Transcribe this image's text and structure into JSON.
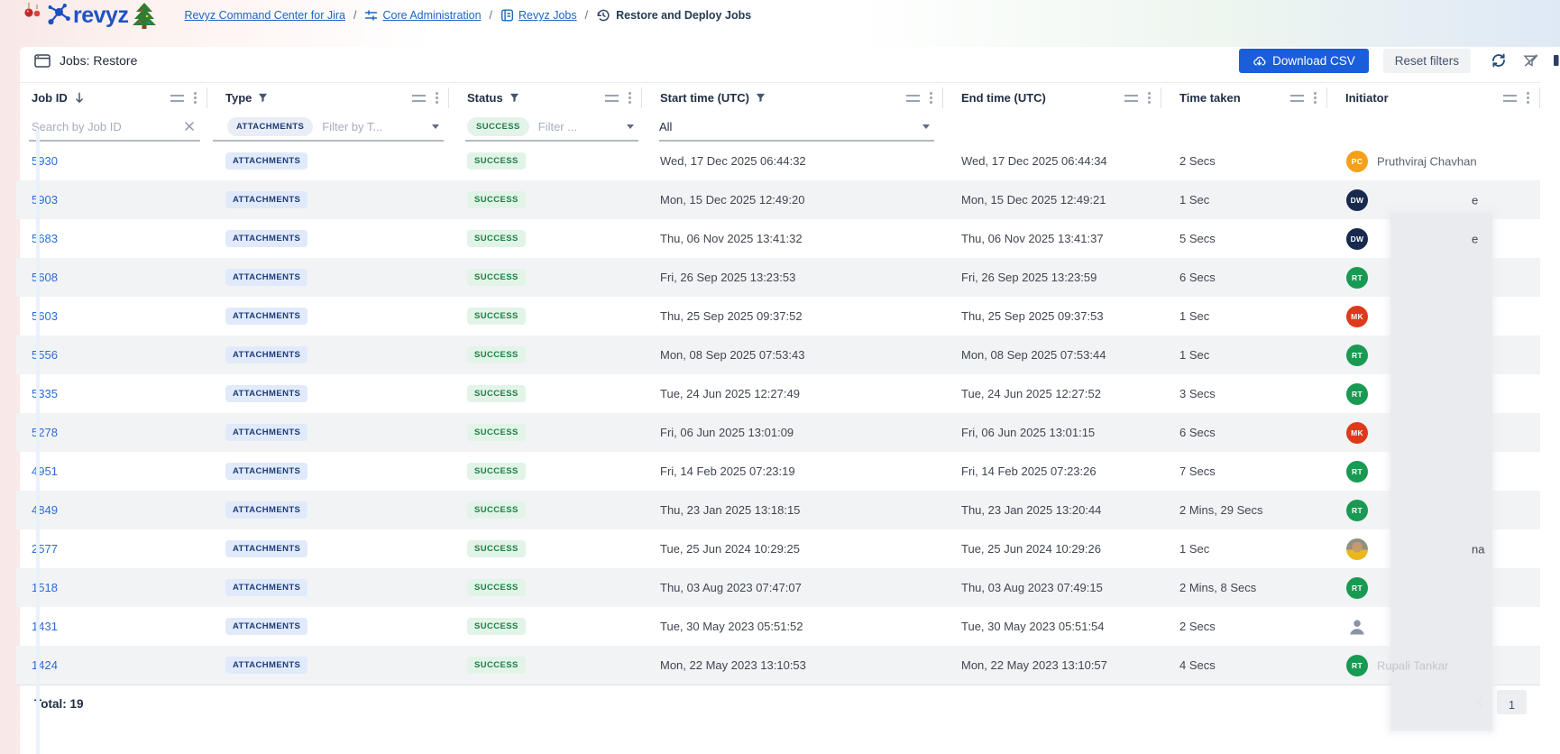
{
  "breadcrumb": {
    "brand": "revyz",
    "separator": "/",
    "items": [
      {
        "label": "Revyz Command Center for Jira"
      },
      {
        "label": "Core Administration",
        "icon": "sliders-icon"
      },
      {
        "label": "Revyz Jobs",
        "icon": "journal-icon"
      },
      {
        "label": "Restore and Deploy Jobs",
        "icon": "history-icon",
        "current": true
      }
    ]
  },
  "toolbar": {
    "title": "Jobs: Restore",
    "download_csv_label": "Download CSV",
    "reset_filters_label": "Reset filters",
    "icons": [
      "download-cloud-icon",
      "refresh-icon",
      "filter-off-icon",
      "columns-icon"
    ]
  },
  "table": {
    "columns": [
      {
        "label": "Job ID",
        "sorted": "desc",
        "filter_active": false
      },
      {
        "label": "Type",
        "filter_active": true
      },
      {
        "label": "Status",
        "filter_active": true
      },
      {
        "label": "Start time (UTC)",
        "filter_active": true
      },
      {
        "label": "End time (UTC)",
        "filter_active": false
      },
      {
        "label": "Time taken",
        "filter_active": false
      },
      {
        "label": "Initiator",
        "filter_active": false
      }
    ],
    "filters": {
      "job_id_placeholder": "Search by Job ID",
      "type_chip": "ATTACHMENTS",
      "type_placeholder": "Filter by T...",
      "status_chip": "SUCCESS",
      "status_placeholder": "Filter ...",
      "start_time_value": "All"
    },
    "rows": [
      {
        "job_id": "5930",
        "type": "ATTACHMENTS",
        "status": "SUCCESS",
        "start": "Wed, 17 Dec 2025 06:44:32",
        "end": "Wed, 17 Dec 2025 06:44:34",
        "time_taken": "2 Secs",
        "initiator": {
          "initials": "PC",
          "color": "#f5a01a",
          "name": "Pruthviraj Chavhan"
        }
      },
      {
        "job_id": "5903",
        "type": "ATTACHMENTS",
        "status": "SUCCESS",
        "start": "Mon, 15 Dec 2025 12:49:20",
        "end": "Mon, 15 Dec 2025 12:49:21",
        "time_taken": "1 Sec",
        "initiator": {
          "initials": "DW",
          "color": "#17294d",
          "fragment": "e"
        }
      },
      {
        "job_id": "5683",
        "type": "ATTACHMENTS",
        "status": "SUCCESS",
        "start": "Thu, 06 Nov 2025 13:41:32",
        "end": "Thu, 06 Nov 2025 13:41:37",
        "time_taken": "5 Secs",
        "initiator": {
          "initials": "DW",
          "color": "#17294d",
          "fragment": "e"
        }
      },
      {
        "job_id": "5608",
        "type": "ATTACHMENTS",
        "status": "SUCCESS",
        "start": "Fri, 26 Sep 2025 13:23:53",
        "end": "Fri, 26 Sep 2025 13:23:59",
        "time_taken": "6 Secs",
        "initiator": {
          "initials": "RT",
          "color": "#189a52"
        }
      },
      {
        "job_id": "5603",
        "type": "ATTACHMENTS",
        "status": "SUCCESS",
        "start": "Thu, 25 Sep 2025 09:37:52",
        "end": "Thu, 25 Sep 2025 09:37:53",
        "time_taken": "1 Sec",
        "initiator": {
          "initials": "MK",
          "color": "#dd3a1c"
        }
      },
      {
        "job_id": "5556",
        "type": "ATTACHMENTS",
        "status": "SUCCESS",
        "start": "Mon, 08 Sep 2025 07:53:43",
        "end": "Mon, 08 Sep 2025 07:53:44",
        "time_taken": "1 Sec",
        "initiator": {
          "initials": "RT",
          "color": "#189a52"
        }
      },
      {
        "job_id": "5335",
        "type": "ATTACHMENTS",
        "status": "SUCCESS",
        "start": "Tue, 24 Jun 2025 12:27:49",
        "end": "Tue, 24 Jun 2025 12:27:52",
        "time_taken": "3 Secs",
        "initiator": {
          "initials": "RT",
          "color": "#189a52"
        }
      },
      {
        "job_id": "5278",
        "type": "ATTACHMENTS",
        "status": "SUCCESS",
        "start": "Fri, 06 Jun 2025 13:01:09",
        "end": "Fri, 06 Jun 2025 13:01:15",
        "time_taken": "6 Secs",
        "initiator": {
          "initials": "MK",
          "color": "#dd3a1c"
        }
      },
      {
        "job_id": "4951",
        "type": "ATTACHMENTS",
        "status": "SUCCESS",
        "start": "Fri, 14 Feb 2025 07:23:19",
        "end": "Fri, 14 Feb 2025 07:23:26",
        "time_taken": "7 Secs",
        "initiator": {
          "initials": "RT",
          "color": "#189a52"
        }
      },
      {
        "job_id": "4849",
        "type": "ATTACHMENTS",
        "status": "SUCCESS",
        "start": "Thu, 23 Jan 2025 13:18:15",
        "end": "Thu, 23 Jan 2025 13:20:44",
        "time_taken": "2 Mins, 29 Secs",
        "initiator": {
          "initials": "RT",
          "color": "#189a52"
        }
      },
      {
        "job_id": "2577",
        "type": "ATTACHMENTS",
        "status": "SUCCESS",
        "start": "Tue, 25 Jun 2024 10:29:25",
        "end": "Tue, 25 Jun 2024 10:29:26",
        "time_taken": "1 Sec",
        "initiator": {
          "avatar": "photo",
          "fragment": "na"
        }
      },
      {
        "job_id": "1518",
        "type": "ATTACHMENTS",
        "status": "SUCCESS",
        "start": "Thu, 03 Aug 2023 07:47:07",
        "end": "Thu, 03 Aug 2023 07:49:15",
        "time_taken": "2 Mins, 8 Secs",
        "initiator": {
          "initials": "RT",
          "color": "#189a52"
        }
      },
      {
        "job_id": "1431",
        "type": "ATTACHMENTS",
        "status": "SUCCESS",
        "start": "Tue, 30 May 2023 05:51:52",
        "end": "Tue, 30 May 2023 05:51:54",
        "time_taken": "2 Secs",
        "initiator": {
          "avatar": "generic"
        }
      },
      {
        "job_id": "1424",
        "type": "ATTACHMENTS",
        "status": "SUCCESS",
        "start": "Mon, 22 May 2023 13:10:53",
        "end": "Mon, 22 May 2023 13:10:57",
        "time_taken": "4 Secs",
        "initiator": {
          "initials": "RT",
          "color": "#189a52",
          "name": "Rupali Tankar",
          "faded": true
        }
      }
    ],
    "footer": {
      "total_label": "Total: 19",
      "page": "1"
    }
  },
  "colors": {
    "primary_button": "#1a5ed9",
    "type_chip_bg": "#e1eafb",
    "type_chip_text": "#1c3c78",
    "status_chip_bg": "#e2f4e8",
    "status_chip_text": "#1e7e45",
    "link": "#2a6cd5",
    "row_alt_bg": "#f2f3f5"
  }
}
